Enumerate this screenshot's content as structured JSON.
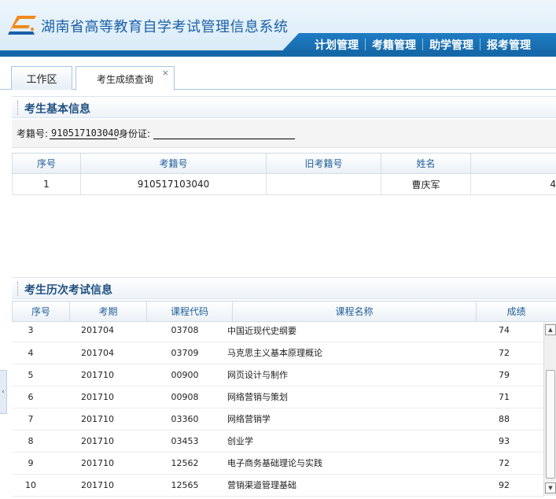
{
  "app": {
    "title": "湖南省高等教育自学考试管理信息系统"
  },
  "nav": [
    "计划管理",
    "考籍管理",
    "助学管理",
    "报考管理"
  ],
  "tabs": {
    "workspace": "工作区",
    "active": "考生成绩查询",
    "close_glyph": "×"
  },
  "basic": {
    "heading": "考生基本信息",
    "exam_no_label": "考籍号:",
    "exam_no_value": "910517103040",
    "id_label": "身份证:",
    "id_value": "",
    "columns": [
      "序号",
      "考籍号",
      "旧考籍号",
      "姓名"
    ],
    "rows": [
      {
        "seq": "1",
        "exam_no": "910517103040",
        "old_no": "",
        "name": "曹庆军",
        "extra": "4"
      }
    ]
  },
  "history": {
    "heading": "考生历次考试信息",
    "columns": [
      "序号",
      "考期",
      "课程代码",
      "课程名称",
      "成绩"
    ],
    "rows": [
      {
        "seq": "3",
        "term": "201704",
        "code": "03708",
        "course": "中国近现代史纲要",
        "score": "74"
      },
      {
        "seq": "4",
        "term": "201704",
        "code": "03709",
        "course": "马克思主义基本原理概论",
        "score": "72"
      },
      {
        "seq": "5",
        "term": "201710",
        "code": "00900",
        "course": "网页设计与制作",
        "score": "79"
      },
      {
        "seq": "6",
        "term": "201710",
        "code": "00908",
        "course": "网络营销与策划",
        "score": "71"
      },
      {
        "seq": "7",
        "term": "201710",
        "code": "03360",
        "course": "网络营销学",
        "score": "88"
      },
      {
        "seq": "8",
        "term": "201710",
        "code": "03453",
        "course": "创业学",
        "score": "93"
      },
      {
        "seq": "9",
        "term": "201710",
        "code": "12562",
        "course": "电子商务基础理论与实践",
        "score": "72"
      },
      {
        "seq": "10",
        "term": "201710",
        "code": "12565",
        "course": "营销渠道管理基础",
        "score": "92"
      }
    ]
  },
  "icons": {
    "logo": "exam-system-logo",
    "collapse": "collapse-left-icon"
  },
  "colors": {
    "brand": "#1a5fa8",
    "nav": "#1568a8",
    "accent": "#f08a1c"
  }
}
